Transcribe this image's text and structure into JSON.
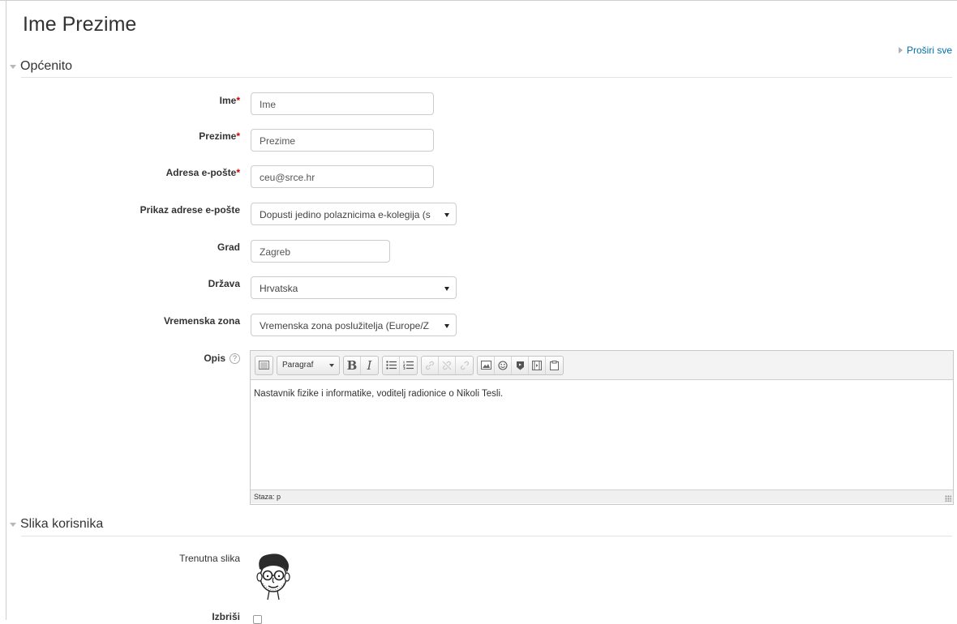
{
  "page": {
    "title": "Ime Prezime",
    "expand_all": "Proširi sve"
  },
  "sections": {
    "general": "Općenito",
    "picture": "Slika korisnika"
  },
  "fields": {
    "first_name": {
      "label": "Ime",
      "required_mark": "*",
      "value": "Ime"
    },
    "last_name": {
      "label": "Prezime",
      "required_mark": "*",
      "value": "Prezime"
    },
    "email": {
      "label": "Adresa e-pošte",
      "required_mark": "*",
      "value": "ceu@srce.hr"
    },
    "email_display": {
      "label": "Prikaz adrese e-pošte",
      "value": "Dopusti jedino polaznicima e-kolegija (s"
    },
    "city": {
      "label": "Grad",
      "value": "Zagreb"
    },
    "country": {
      "label": "Država",
      "value": "Hrvatska"
    },
    "timezone": {
      "label": "Vremenska zona",
      "value": "Vremenska zona poslužitelja (Europe/Z"
    },
    "description": {
      "label": "Opis",
      "help": "?",
      "paragraph_format": "Paragraf",
      "bold": "B",
      "italic": "I",
      "content": "Nastavnik fizike i informatike, voditelj radionice o Nikoli Tesli.",
      "path": "Staza: p"
    },
    "current_picture": {
      "label": "Trenutna slika"
    },
    "delete": {
      "label": "Izbriši"
    }
  },
  "icons": {
    "toolbar": [
      "toggle-toolbar-icon",
      "unordered-list-icon",
      "ordered-list-icon",
      "link-icon",
      "unlink-icon",
      "anchor-icon",
      "image-icon",
      "emoticon-icon",
      "media-icon",
      "video-icon",
      "paste-icon"
    ]
  },
  "colors": {
    "link": "#0070a8",
    "required": "#d00000"
  }
}
